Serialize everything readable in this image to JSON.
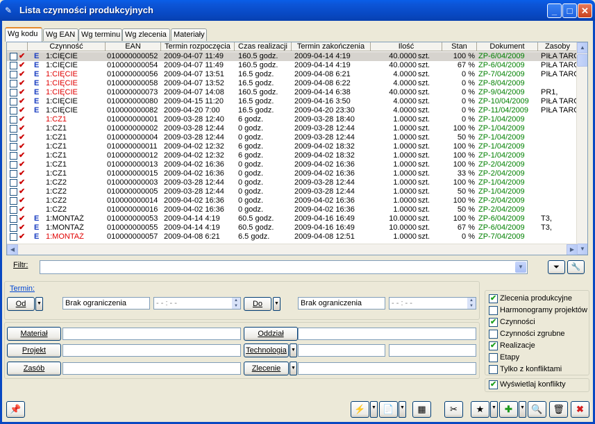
{
  "window": {
    "title": "Lista czynności produkcyjnych"
  },
  "tabs": [
    "Wg kodu",
    "Wg EAN",
    "Wg terminu",
    "Wg zlecenia",
    "Materiały"
  ],
  "grid": {
    "headers": [
      "Czynność",
      "EAN",
      "Termin rozpoczęcia",
      "Czas realizacji",
      "Termin zakończenia",
      "Ilość",
      "Stan",
      "Dokument",
      "Zasoby"
    ],
    "rows": [
      {
        "e": "E",
        "czynnosc": "1:CIĘCIE",
        "red": false,
        "ean": "010000000052",
        "start": "2009-04-07 11:49",
        "czas": "160.5 godz.",
        "koniec": "2009-04-14  4:19",
        "ilosc": "40.0000",
        "jm": "szt.",
        "stan": "100 %",
        "dok": "ZP-6/04/2009",
        "zasoby": "PIŁA TARC"
      },
      {
        "e": "E",
        "czynnosc": "1:CIĘCIE",
        "red": false,
        "ean": "010000000054",
        "start": "2009-04-07 11:49",
        "czas": "160.5 godz.",
        "koniec": "2009-04-14  4:19",
        "ilosc": "40.0000",
        "jm": "szt.",
        "stan": "67 %",
        "dok": "ZP-6/04/2009",
        "zasoby": "PIŁA TARC"
      },
      {
        "e": "E",
        "czynnosc": "1:CIĘCIE",
        "red": true,
        "ean": "010000000056",
        "start": "2009-04-07 13:51",
        "czas": "16.5 godz.",
        "koniec": "2009-04-08  6:21",
        "ilosc": "4.0000",
        "jm": "szt.",
        "stan": "0 %",
        "dok": "ZP-7/04/2009",
        "zasoby": "PIŁA TARC"
      },
      {
        "e": "E",
        "czynnosc": "1:CIĘCIE",
        "red": true,
        "ean": "010000000058",
        "start": "2009-04-07 13:52",
        "czas": "16.5 godz.",
        "koniec": "2009-04-08  6:22",
        "ilosc": "4.0000",
        "jm": "szt.",
        "stan": "0 %",
        "dok": "ZP-8/04/2009",
        "zasoby": ""
      },
      {
        "e": "E",
        "czynnosc": "1:CIĘCIE",
        "red": true,
        "ean": "010000000073",
        "start": "2009-04-07 14:08",
        "czas": "160.5 godz.",
        "koniec": "2009-04-14  6:38",
        "ilosc": "40.0000",
        "jm": "szt.",
        "stan": "0 %",
        "dok": "ZP-9/04/2009",
        "zasoby": "PR1,"
      },
      {
        "e": "E",
        "czynnosc": "1:CIĘCIE",
        "red": false,
        "ean": "010000000080",
        "start": "2009-04-15 11:20",
        "czas": "16.5 godz.",
        "koniec": "2009-04-16  3:50",
        "ilosc": "4.0000",
        "jm": "szt.",
        "stan": "0 %",
        "dok": "ZP-10/04/2009",
        "zasoby": "PIŁA TARC"
      },
      {
        "e": "E",
        "czynnosc": "1:CIĘCIE",
        "red": false,
        "ean": "010000000082",
        "start": "2009-04-20  7:00",
        "czas": "16.5 godz.",
        "koniec": "2009-04-20 23:30",
        "ilosc": "4.0000",
        "jm": "szt.",
        "stan": "0 %",
        "dok": "ZP-11/04/2009",
        "zasoby": "PIŁA TARC"
      },
      {
        "e": "",
        "czynnosc": "1:CZ1",
        "red": true,
        "ean": "010000000001",
        "start": "2009-03-28 12:40",
        "czas": "6 godz.",
        "koniec": "2009-03-28 18:40",
        "ilosc": "1.0000",
        "jm": "szt.",
        "stan": "0 %",
        "dok": "ZP-1/04/2009",
        "zasoby": ""
      },
      {
        "e": "",
        "czynnosc": "1:CZ1",
        "red": false,
        "ean": "010000000002",
        "start": "2009-03-28 12:44",
        "czas": "0 godz.",
        "koniec": "2009-03-28 12:44",
        "ilosc": "1.0000",
        "jm": "szt.",
        "stan": "100 %",
        "dok": "ZP-1/04/2009",
        "zasoby": ""
      },
      {
        "e": "",
        "czynnosc": "1:CZ1",
        "red": false,
        "ean": "010000000004",
        "start": "2009-03-28 12:44",
        "czas": "0 godz.",
        "koniec": "2009-03-28 12:44",
        "ilosc": "1.0000",
        "jm": "szt.",
        "stan": "50 %",
        "dok": "ZP-1/04/2009",
        "zasoby": ""
      },
      {
        "e": "",
        "czynnosc": "1:CZ1",
        "red": false,
        "ean": "010000000011",
        "start": "2009-04-02 12:32",
        "czas": "6 godz.",
        "koniec": "2009-04-02 18:32",
        "ilosc": "1.0000",
        "jm": "szt.",
        "stan": "100 %",
        "dok": "ZP-1/04/2009",
        "zasoby": ""
      },
      {
        "e": "",
        "czynnosc": "1:CZ1",
        "red": false,
        "ean": "010000000012",
        "start": "2009-04-02 12:32",
        "czas": "6 godz.",
        "koniec": "2009-04-02 18:32",
        "ilosc": "1.0000",
        "jm": "szt.",
        "stan": "100 %",
        "dok": "ZP-1/04/2009",
        "zasoby": ""
      },
      {
        "e": "",
        "czynnosc": "1:CZ1",
        "red": false,
        "ean": "010000000013",
        "start": "2009-04-02 16:36",
        "czas": "0 godz.",
        "koniec": "2009-04-02 16:36",
        "ilosc": "1.0000",
        "jm": "szt.",
        "stan": "100 %",
        "dok": "ZP-2/04/2009",
        "zasoby": ""
      },
      {
        "e": "",
        "czynnosc": "1:CZ1",
        "red": false,
        "ean": "010000000015",
        "start": "2009-04-02 16:36",
        "czas": "0 godz.",
        "koniec": "2009-04-02 16:36",
        "ilosc": "1.0000",
        "jm": "szt.",
        "stan": "33 %",
        "dok": "ZP-2/04/2009",
        "zasoby": ""
      },
      {
        "e": "",
        "czynnosc": "1:CZ2",
        "red": false,
        "ean": "010000000003",
        "start": "2009-03-28 12:44",
        "czas": "0 godz.",
        "koniec": "2009-03-28 12:44",
        "ilosc": "1.0000",
        "jm": "szt.",
        "stan": "100 %",
        "dok": "ZP-1/04/2009",
        "zasoby": ""
      },
      {
        "e": "",
        "czynnosc": "1:CZ2",
        "red": false,
        "ean": "010000000005",
        "start": "2009-03-28 12:44",
        "czas": "0 godz.",
        "koniec": "2009-03-28 12:44",
        "ilosc": "1.0000",
        "jm": "szt.",
        "stan": "50 %",
        "dok": "ZP-1/04/2009",
        "zasoby": ""
      },
      {
        "e": "",
        "czynnosc": "1:CZ2",
        "red": false,
        "ean": "010000000014",
        "start": "2009-04-02 16:36",
        "czas": "0 godz.",
        "koniec": "2009-04-02 16:36",
        "ilosc": "1.0000",
        "jm": "szt.",
        "stan": "100 %",
        "dok": "ZP-2/04/2009",
        "zasoby": ""
      },
      {
        "e": "",
        "czynnosc": "1:CZ2",
        "red": false,
        "ean": "010000000016",
        "start": "2009-04-02 16:36",
        "czas": "0 godz.",
        "koniec": "2009-04-02 16:36",
        "ilosc": "1.0000",
        "jm": "szt.",
        "stan": "50 %",
        "dok": "ZP-2/04/2009",
        "zasoby": ""
      },
      {
        "e": "E",
        "czynnosc": "1:MONTAŻ",
        "red": false,
        "ean": "010000000053",
        "start": "2009-04-14  4:19",
        "czas": "60.5 godz.",
        "koniec": "2009-04-16 16:49",
        "ilosc": "10.0000",
        "jm": "szt.",
        "stan": "100 %",
        "dok": "ZP-6/04/2009",
        "zasoby": "T3,"
      },
      {
        "e": "E",
        "czynnosc": "1:MONTAŻ",
        "red": false,
        "ean": "010000000055",
        "start": "2009-04-14  4:19",
        "czas": "60.5 godz.",
        "koniec": "2009-04-16 16:49",
        "ilosc": "10.0000",
        "jm": "szt.",
        "stan": "67 %",
        "dok": "ZP-6/04/2009",
        "zasoby": "T3,"
      },
      {
        "e": "E",
        "czynnosc": "1:MONTAŻ",
        "red": true,
        "ean": "010000000057",
        "start": "2009-04-08  6:21",
        "czas": "6.5 godz.",
        "koniec": "2009-04-08 12:51",
        "ilosc": "1.0000",
        "jm": "szt.",
        "stan": "0 %",
        "dok": "ZP-7/04/2009",
        "zasoby": ""
      }
    ]
  },
  "filter": {
    "label": "Filtr:",
    "value": ""
  },
  "termin": {
    "label": "Termin:",
    "od_label": "Od",
    "do_label": "Do",
    "od_value": "Brak ograniczenia",
    "do_value": "Brak ograniczenia",
    "od_time": "- - : - -",
    "do_time": "- - : - -"
  },
  "fields": {
    "material": "Materiał",
    "projekt": "Projekt",
    "zasob": "Zasób",
    "oddzial": "Oddział",
    "technologia": "Technologia",
    "zlecenie": "Zlecenie"
  },
  "checks": [
    {
      "label": "Zlecenia produkcyjne",
      "checked": true
    },
    {
      "label": "Harmonogramy projektów",
      "checked": false
    },
    {
      "label": "Czynności",
      "checked": true
    },
    {
      "label": "Czynności zgrubne",
      "checked": false
    },
    {
      "label": "Realizacje",
      "checked": true
    },
    {
      "label": "Etapy",
      "checked": false
    },
    {
      "label": "Tylko z konfliktami",
      "checked": false
    }
  ],
  "show_conflicts": {
    "label": "Wyświetlaj konflikty",
    "checked": true
  },
  "colors": {
    "accent": "#0848c2",
    "doc_green": "#008000",
    "conflict_red": "#e00000"
  },
  "icons": [
    "pin-icon",
    "lightning-icon",
    "document-check-icon",
    "calendar-list-icon",
    "scissors-icon",
    "document-star-icon",
    "plus-icon",
    "magnifier-icon",
    "trash-icon",
    "close-icon",
    "filter-icon",
    "wrench-icon"
  ]
}
